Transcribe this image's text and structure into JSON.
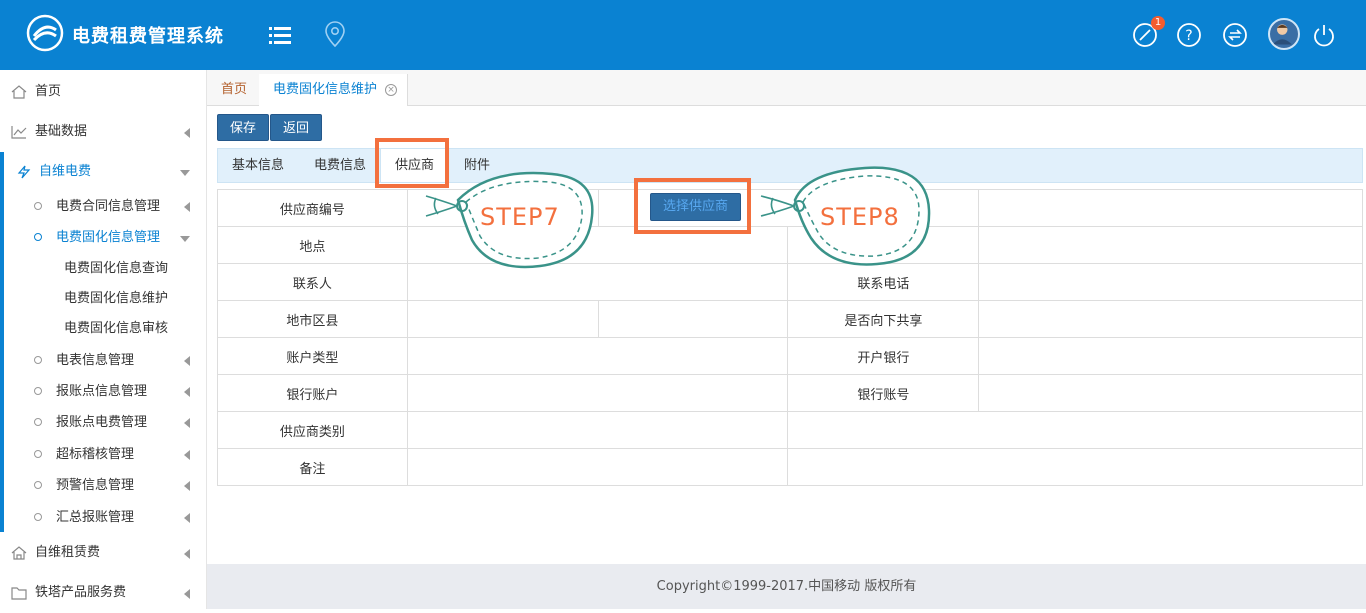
{
  "header": {
    "title": "电费租费管理系统",
    "badge_count": "1",
    "brand_color": "#0a82d2"
  },
  "sidebar": {
    "items": [
      {
        "label": "首页",
        "icon": "home-icon"
      },
      {
        "label": "基础数据",
        "icon": "chart-line-icon"
      },
      {
        "label": "自维电费",
        "icon": "lightning-icon"
      },
      {
        "label": "自维租赁费",
        "icon": "house-icon"
      },
      {
        "label": "铁塔产品服务费",
        "icon": "folder-icon"
      }
    ],
    "sub_items": [
      {
        "label": "电费合同信息管理"
      },
      {
        "label": "电费固化信息管理"
      },
      {
        "label": "电表信息管理"
      },
      {
        "label": "报账点信息管理"
      },
      {
        "label": "报账点电费管理"
      },
      {
        "label": "超标稽核管理"
      },
      {
        "label": "预警信息管理"
      },
      {
        "label": "汇总报账管理"
      }
    ],
    "subsub_items": [
      {
        "label": "电费固化信息查询"
      },
      {
        "label": "电费固化信息维护"
      },
      {
        "label": "电费固化信息审核"
      }
    ]
  },
  "tabs": {
    "home": "首页",
    "current": "电费固化信息维护",
    "close_glyph": "×"
  },
  "toolbar": {
    "save_label": "保存",
    "back_label": "返回"
  },
  "inner_tabs": [
    {
      "label": "基本信息"
    },
    {
      "label": "电费信息"
    },
    {
      "label": "供应商"
    },
    {
      "label": "附件"
    }
  ],
  "form": {
    "supplier_code": "供应商编号",
    "select_supplier": "选择供应商",
    "location": "地点",
    "contact": "联系人",
    "contact_phone": "联系电话",
    "region": "地市区县",
    "share_down": "是否向下共享",
    "account_type": "账户类型",
    "opening_bank": "开户银行",
    "bank_account": "银行账户",
    "bank_account_no": "银行账号",
    "supplier_type": "供应商类别",
    "remark": "备注"
  },
  "annotations": {
    "step7": "STEP7",
    "step8": "STEP8",
    "accent_color": "#f3703e"
  },
  "footer": {
    "copyright": "Copyright©1999-2017.中国移动 版权所有"
  }
}
